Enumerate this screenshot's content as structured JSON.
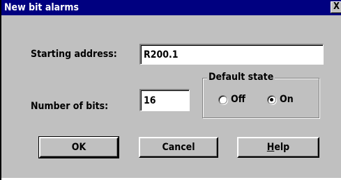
{
  "window": {
    "title": "New bit alarms",
    "close_glyph": "X"
  },
  "form": {
    "starting_address_label": "Starting address:",
    "starting_address_value": "R200.1",
    "number_of_bits_label": "Number of bits:",
    "number_of_bits_value": "16"
  },
  "default_state": {
    "legend": "Default state",
    "options": [
      {
        "label": "Off",
        "selected": false
      },
      {
        "label": "On",
        "selected": true
      }
    ]
  },
  "buttons": {
    "ok_label": "OK",
    "cancel_label": "Cancel",
    "help_label_accel": "H",
    "help_label_rest": "elp"
  },
  "colors": {
    "title_bar": "#000080",
    "dialog_face": "#c0c0c0"
  }
}
